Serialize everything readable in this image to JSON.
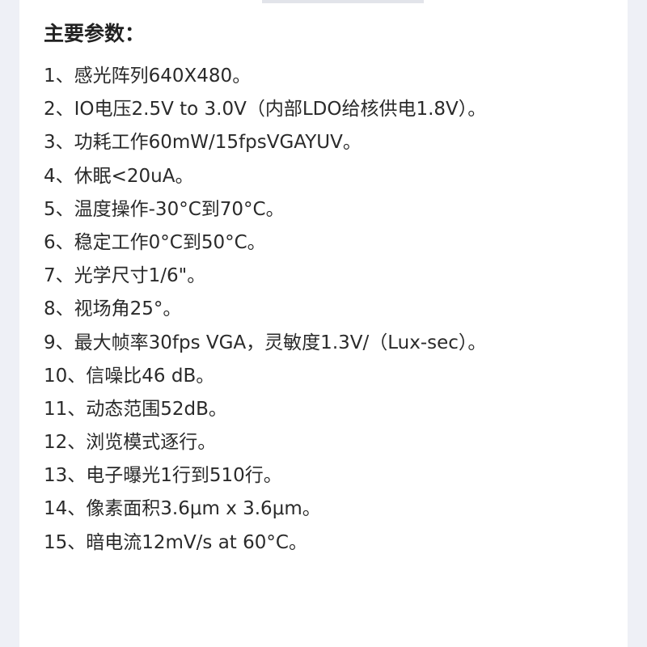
{
  "title": "主要参数：",
  "specs": [
    "1、感光阵列640X480。",
    "2、IO电压2.5V to 3.0V（内部LDO给核供电1.8V）。",
    "3、功耗工作60mW/15fpsVGAYUV。",
    "4、休眠<20uA。",
    "5、温度操作-30°C到70°C。",
    "6、稳定工作0°C到50°C。",
    "7、光学尺寸1/6\"。",
    "8、视场角25°。",
    "9、最大帧率30fps VGA，灵敏度1.3V/（Lux-sec）。",
    "10、信噪比46 dB。",
    "11、动态范围52dB。",
    "12、浏览模式逐行。",
    "13、电子曝光1行到510行。",
    "14、像素面积3.6μm x 3.6μm。",
    "15、暗电流12mV/s at 60°C。"
  ]
}
